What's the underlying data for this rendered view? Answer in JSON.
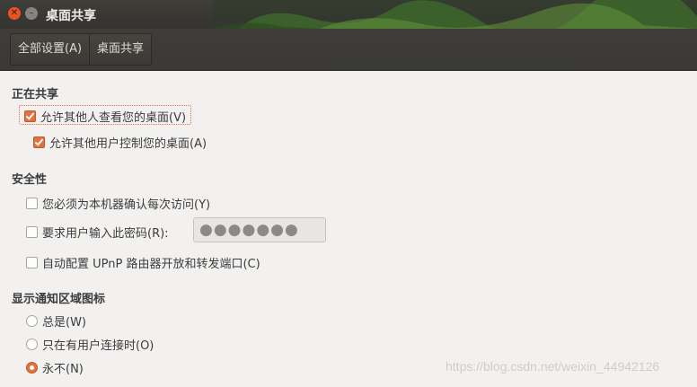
{
  "window": {
    "title": "桌面共享"
  },
  "toolbar": {
    "crumbs": [
      "全部设置(A)",
      "桌面共享"
    ]
  },
  "sharing": {
    "title": "正在共享",
    "allow_view": {
      "label": "允许其他人查看您的桌面(V)",
      "checked": true
    },
    "allow_control": {
      "label": "允许其他用户控制您的桌面(A)",
      "checked": true
    }
  },
  "security": {
    "title": "安全性",
    "confirm_access": {
      "label": "您必须为本机器确认每次访问(Y)",
      "checked": false
    },
    "require_password": {
      "label": "要求用户输入此密码(R):",
      "checked": false
    },
    "password_value": "●●●●●●●",
    "upnp": {
      "label": "自动配置 UPnP 路由器开放和转发端口(C)",
      "checked": false
    }
  },
  "notification": {
    "title": "显示通知区域图标",
    "options": [
      {
        "label": "总是(W)",
        "selected": false
      },
      {
        "label": "只在有用户连接时(O)",
        "selected": false
      },
      {
        "label": "永不(N)",
        "selected": true
      }
    ]
  },
  "watermark": "https://blog.csdn.net/weixin_44942126",
  "colors": {
    "accent": "#e2713e",
    "titlebar": "#3a3935",
    "background": "#f2f1f0"
  }
}
